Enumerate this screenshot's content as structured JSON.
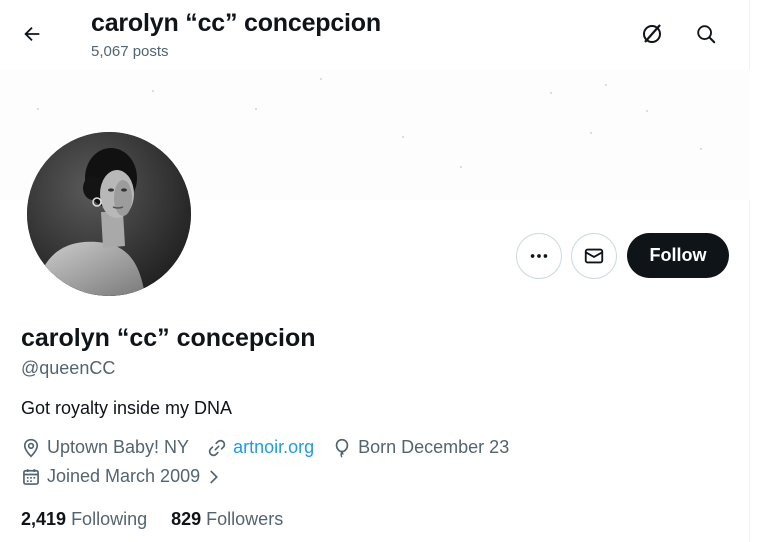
{
  "header": {
    "title": "carolyn “cc” concepcion",
    "posts_count": "5,067 posts"
  },
  "profile": {
    "display_name": "carolyn “cc” concepcion",
    "handle": "@queenCC",
    "bio": "Got royalty inside my DNA",
    "location": "Uptown Baby! NY",
    "website": "artnoir.org",
    "birthday": "Born December 23",
    "joined": "Joined March 2009"
  },
  "actions": {
    "follow_label": "Follow"
  },
  "stats": {
    "following_count": "2,419",
    "following_label": "Following",
    "followers_count": "829",
    "followers_label": "Followers"
  },
  "colors": {
    "primary_text": "#0f1419",
    "secondary_text": "#536471",
    "link": "#1d9bf0",
    "follow_bg": "#0f1419"
  },
  "icons": {
    "back": "arrow-left-icon",
    "grok": "grok-icon",
    "search": "search-icon",
    "more": "more-icon",
    "message": "envelope-icon",
    "location": "location-pin-icon",
    "link": "link-icon",
    "birthday": "balloon-icon",
    "joined": "calendar-icon",
    "chevron": "chevron-right-icon"
  }
}
